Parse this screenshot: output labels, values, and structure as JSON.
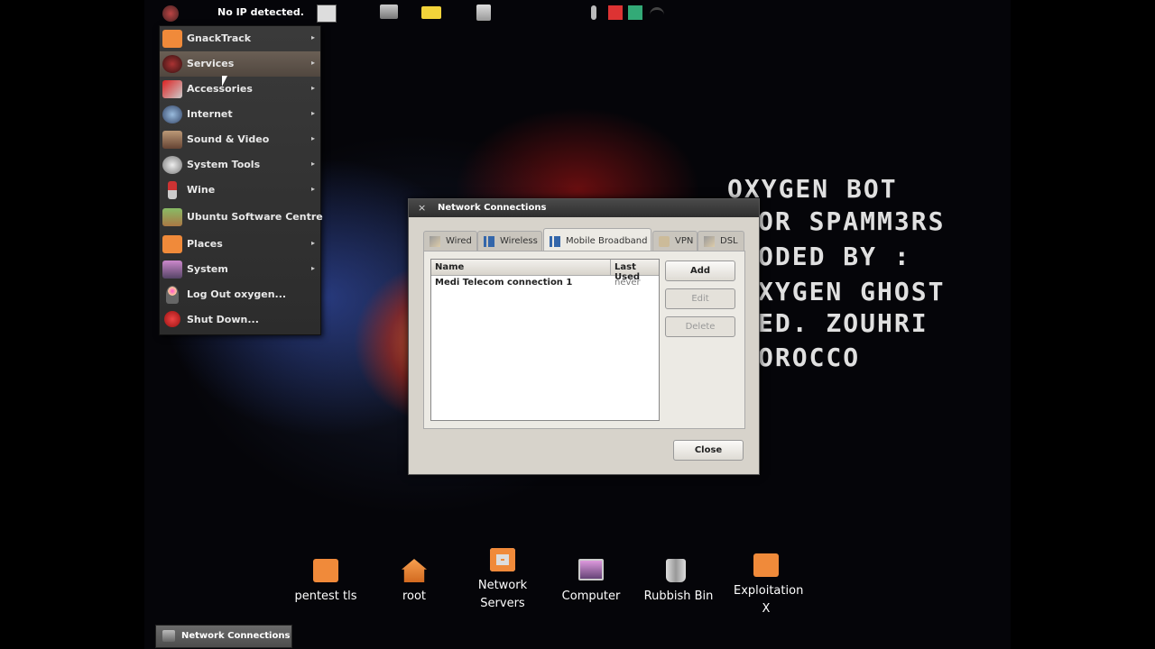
{
  "top_panel": {
    "status": "No IP detected."
  },
  "menu": {
    "items": [
      {
        "label": "GnackTrack",
        "submenu": true
      },
      {
        "label": "Services",
        "submenu": true
      },
      {
        "label": "Accessories",
        "submenu": true
      },
      {
        "label": "Internet",
        "submenu": true
      },
      {
        "label": "Sound & Video",
        "submenu": true
      },
      {
        "label": "System Tools",
        "submenu": true
      },
      {
        "label": "Wine",
        "submenu": true
      },
      {
        "label": "Ubuntu Software Centre",
        "submenu": false
      },
      {
        "label": "Places",
        "submenu": true
      },
      {
        "label": "System",
        "submenu": true
      },
      {
        "label": "Log Out oxygen...",
        "submenu": false
      },
      {
        "label": "Shut Down...",
        "submenu": false
      }
    ],
    "arrow": "▸"
  },
  "dialog": {
    "title": "Network Connections",
    "close_x": "×",
    "tabs": [
      "Wired",
      "Wireless",
      "Mobile Broadband",
      "VPN",
      "DSL"
    ],
    "columns": [
      "Name",
      "Last Used"
    ],
    "rows": [
      {
        "name": "Medi Telecom connection 1",
        "last_used": "never"
      }
    ],
    "buttons": {
      "add": "Add",
      "edit": "Edit",
      "delete": "Delete",
      "close": "Close"
    }
  },
  "overlay": {
    "lines": [
      "OXYGEN BOT",
      "OR SPAMM3RS",
      "ODED BY :",
      "XYGEN GHOST",
      "ED. ZOUHRI",
      "OROCCO"
    ]
  },
  "desktop_icons": [
    {
      "label": "pentest tls"
    },
    {
      "label": "root"
    },
    {
      "label": "Network Servers"
    },
    {
      "label": "Computer"
    },
    {
      "label": "Rubbish Bin"
    },
    {
      "label": "Exploitation X"
    }
  ],
  "taskbar": {
    "item": "Network Connections"
  },
  "colors": {
    "folder": "#f08a3a",
    "panel": "#2c2c2c",
    "dialog": "#dcd9d1",
    "active_tab": "#eceae4"
  }
}
